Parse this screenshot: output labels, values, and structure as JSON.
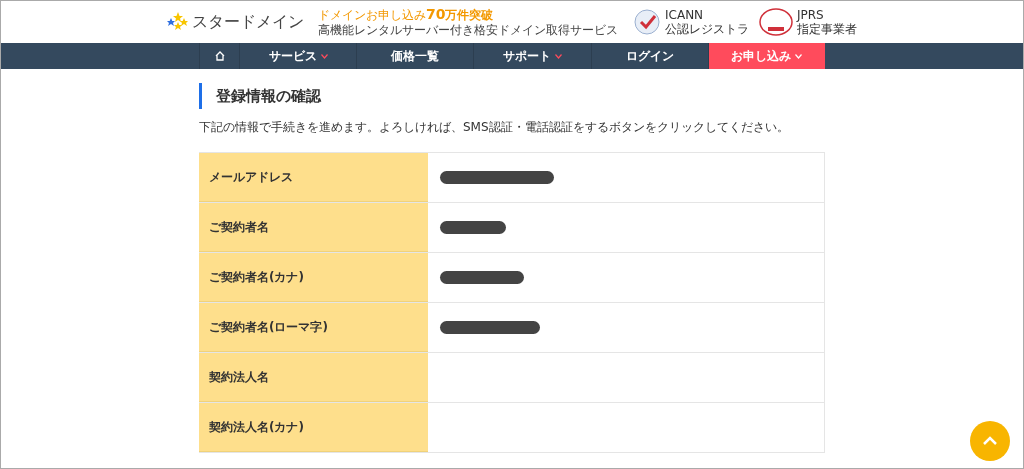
{
  "header": {
    "logo_text": "スタードメイン",
    "tagline_prefix": "ドメインお申し込み",
    "tagline_number": "70",
    "tagline_suffix": "万件突破",
    "subtitle": "高機能レンタルサーバー付き格安ドメイン取得サービス",
    "badges": [
      {
        "kind": "icann",
        "line1": "ICANN",
        "line2": "公認レジストラ"
      },
      {
        "kind": "jprs",
        "line1": "JPRS",
        "line2": "指定事業者"
      }
    ]
  },
  "nav": [
    {
      "kind": "home",
      "has_menu": false,
      "highlighted": false
    },
    {
      "kind": "text",
      "label": "サービス",
      "has_menu": true,
      "highlighted": false
    },
    {
      "kind": "text",
      "label": "価格一覧",
      "has_menu": false,
      "highlighted": false
    },
    {
      "kind": "text",
      "label": "サポート",
      "has_menu": true,
      "highlighted": false
    },
    {
      "kind": "text",
      "label": "ログイン",
      "has_menu": false,
      "highlighted": false
    },
    {
      "kind": "text",
      "label": "お申し込み",
      "has_menu": true,
      "highlighted": true
    }
  ],
  "page": {
    "title": "登録情報の確認",
    "description": "下記の情報で手続きを進めます。よろしければ、SMS認証・電話認証をするボタンをクリックしてください。"
  },
  "table": {
    "rows": [
      {
        "label": "メールアドレス",
        "redacted": true
      },
      {
        "label": "ご契約者名",
        "redacted": true
      },
      {
        "label": "ご契約者名(カナ)",
        "redacted": true
      },
      {
        "label": "ご契約者名(ローマ字)",
        "redacted": true
      },
      {
        "label": "契約法人名",
        "redacted": false
      },
      {
        "label": "契約法人名(カナ)",
        "redacted": false
      }
    ]
  }
}
